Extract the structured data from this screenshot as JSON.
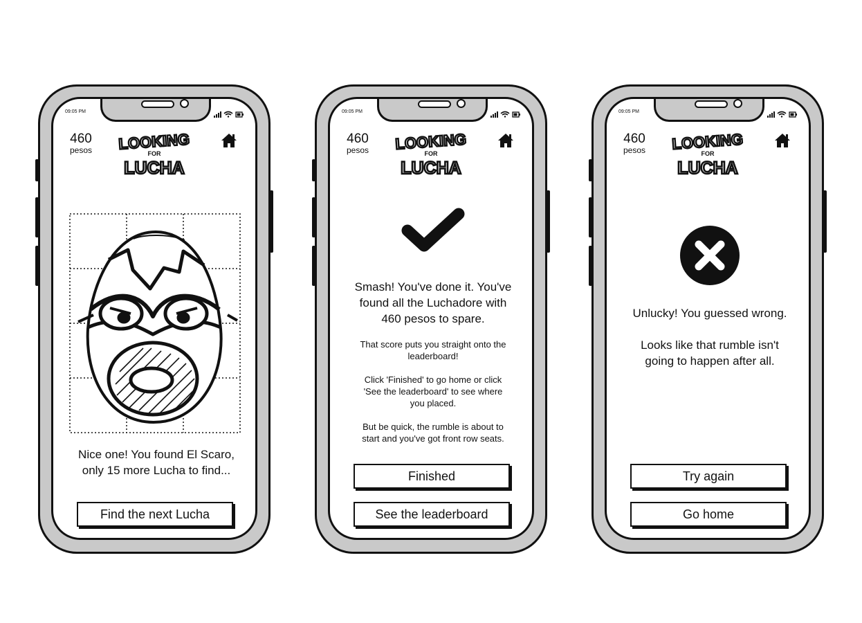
{
  "status": {
    "time": "09:05 PM"
  },
  "header": {
    "pesos_amount": "460",
    "pesos_unit": "pesos",
    "logo_line1": "LOOKING",
    "logo_line2": "FOR",
    "logo_line3": "LUCHA"
  },
  "screens": {
    "found": {
      "message_line1": "Nice one! You found El Scaro,",
      "message_line2": "only 15 more Lucha to find...",
      "button_label": "Find the next Lucha"
    },
    "success": {
      "heading_line1": "Smash! You've done it. You've",
      "heading_line2": "found all the Luchadore with",
      "heading_line3": "460 pesos to spare.",
      "para1_line1": "That score puts you straight onto the",
      "para1_line2": "leaderboard!",
      "para2_line1": "Click 'Finished' to go home or click",
      "para2_line2": "'See the leaderboard' to see where",
      "para2_line3": "you placed.",
      "para3_line1": "But be quick, the rumble is about to",
      "para3_line2": "start and you've got front row seats.",
      "finished_label": "Finished",
      "leaderboard_label": "See the leaderboard"
    },
    "fail": {
      "heading": "Unlucky! You guessed wrong.",
      "sub_line1": "Looks like that rumble isn't",
      "sub_line2": "going to happen after all.",
      "try_again_label": "Try again",
      "go_home_label": "Go home"
    }
  }
}
